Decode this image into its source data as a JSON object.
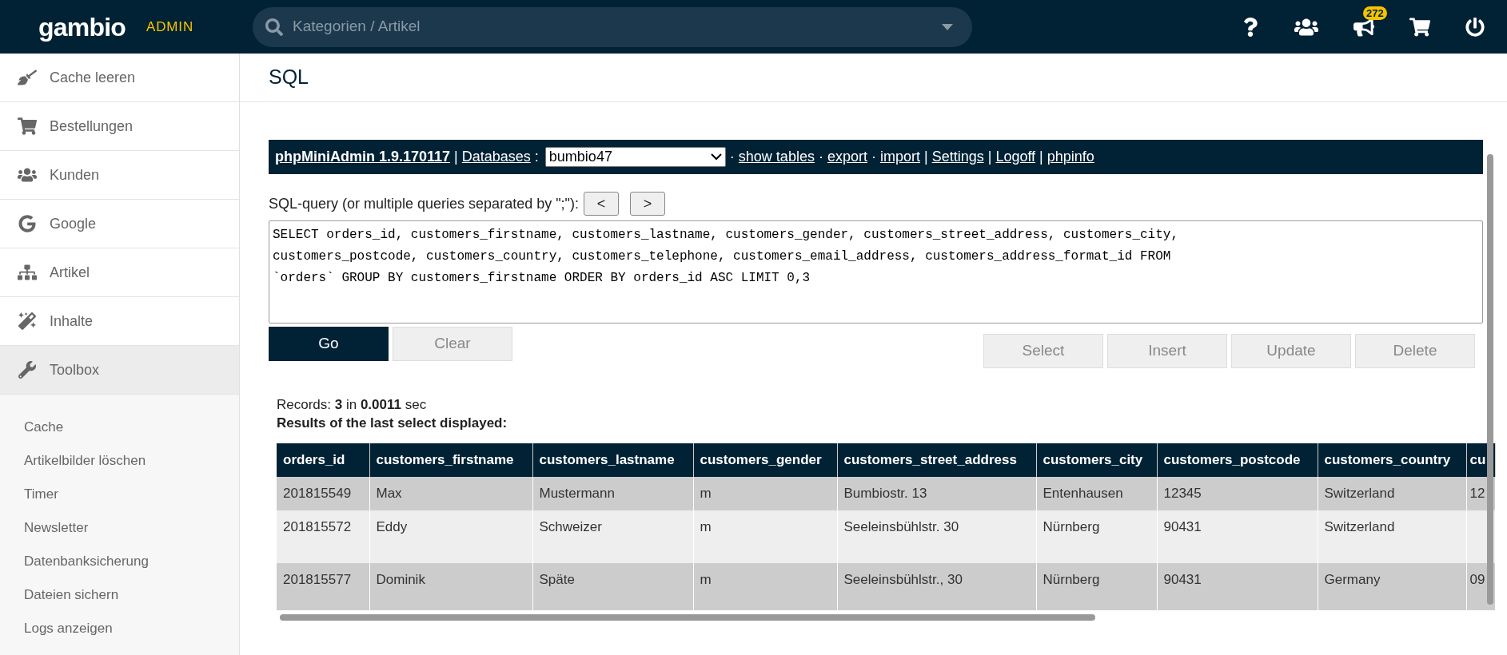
{
  "header": {
    "logo": "gambio",
    "logo_badge": "ADMIN",
    "search": {
      "placeholder": "Kategorien / Artikel"
    },
    "notification_count": "272"
  },
  "sidebar": {
    "items": [
      {
        "label": "Cache leeren",
        "selected": false
      },
      {
        "label": "Bestellungen",
        "selected": false
      },
      {
        "label": "Kunden",
        "selected": false
      },
      {
        "label": "Google",
        "selected": false
      },
      {
        "label": "Artikel",
        "selected": false
      },
      {
        "label": "Inhalte",
        "selected": false
      },
      {
        "label": "Toolbox",
        "selected": true
      }
    ],
    "subitems": [
      "Cache",
      "Artikelbilder löschen",
      "Timer",
      "Newsletter",
      "Datenbanksicherung",
      "Dateien sichern",
      "Logs anzeigen"
    ]
  },
  "page_title": "SQL",
  "toolbar": [
    {
      "kind": "brand",
      "text": "phpMiniAdmin 1.9.170117"
    },
    {
      "kind": "sep",
      "text": "|"
    },
    {
      "kind": "link",
      "text": "Databases"
    },
    {
      "kind": "sep",
      "text": ":"
    },
    {
      "kind": "select",
      "text": "bumbio47"
    },
    {
      "kind": "sep",
      "text": "·"
    },
    {
      "kind": "link",
      "text": "show tables"
    },
    {
      "kind": "sep",
      "text": "·"
    },
    {
      "kind": "link",
      "text": "export"
    },
    {
      "kind": "sep",
      "text": "·"
    },
    {
      "kind": "link",
      "text": "import"
    },
    {
      "kind": "sep",
      "text": "|"
    },
    {
      "kind": "link",
      "text": "Settings"
    },
    {
      "kind": "sep",
      "text": "|"
    },
    {
      "kind": "link",
      "text": "Logoff"
    },
    {
      "kind": "sep",
      "text": "|"
    },
    {
      "kind": "link",
      "text": "phpinfo"
    }
  ],
  "query": {
    "label": "SQL-query (or multiple queries separated by \";\"):",
    "prev": "<",
    "next": ">",
    "value": "SELECT orders_id, customers_firstname, customers_lastname, customers_gender, customers_street_address, customers_city, customers_postcode, customers_country, customers_telephone, customers_email_address, customers_address_format_id FROM `orders` GROUP BY customers_firstname ORDER BY orders_id ASC LIMIT 0,3"
  },
  "buttons": [
    {
      "label": "Go",
      "kind": "primary"
    },
    {
      "label": "Clear",
      "kind": "secondary"
    }
  ],
  "builder_buttons": [
    "Select",
    "Insert",
    "Update",
    "Delete"
  ],
  "records": "Records: **3** in **0.0011** sec",
  "results_note": "Results of the last select displayed:",
  "table": {
    "columns": [
      "orders_id",
      "customers_firstname",
      "customers_lastname",
      "customers_gender",
      "customers_street_address",
      "customers_city",
      "customers_postcode",
      "customers_country",
      "cu"
    ],
    "rows": [
      [
        "201815549",
        "Max",
        "Mustermann",
        "m",
        "Bumbiostr. 13",
        "Entenhausen",
        "12345",
        "Switzerland",
        "12"
      ],
      [
        "201815572",
        "Eddy",
        "Schweizer",
        "m",
        "Seeleinsbühlstr. 30",
        "Nürnberg",
        "90431",
        "Switzerland",
        null
      ],
      [
        "201815577",
        "Dominik",
        "Späte",
        "m",
        "Seeleinsbühlstr., 30",
        "Nürnberg",
        "90431",
        "Germany",
        "09"
      ]
    ]
  }
}
